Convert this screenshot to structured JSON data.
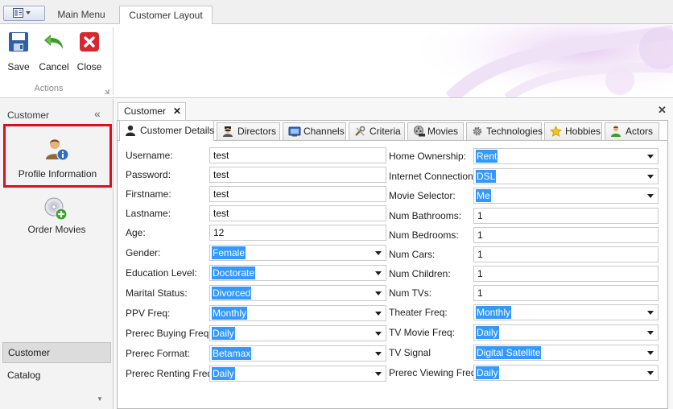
{
  "app_tabs": {
    "main_menu": "Main Menu",
    "customer_layout": "Customer Layout"
  },
  "ribbon": {
    "save": "Save",
    "cancel": "Cancel",
    "close": "Close",
    "group_caption": "Actions"
  },
  "nav": {
    "title": "Customer",
    "collapse_glyph": "«",
    "items": [
      {
        "label": "Profile Information",
        "icon": "user-info-icon"
      },
      {
        "label": "Order Movies",
        "icon": "cd-add-icon"
      }
    ],
    "groups": [
      "Customer",
      "Catalog"
    ]
  },
  "document": {
    "tab_label": "Customer",
    "close_glyph": "✕"
  },
  "tabs": [
    {
      "label": "Customer Details",
      "icon": "person-icon"
    },
    {
      "label": "Directors",
      "icon": "director-icon"
    },
    {
      "label": "Channels",
      "icon": "tv-icon"
    },
    {
      "label": "Criteria",
      "icon": "tools-icon"
    },
    {
      "label": "Movies",
      "icon": "film-reel-icon"
    },
    {
      "label": "Technologies",
      "icon": "gear-icon"
    },
    {
      "label": "Hobbies",
      "icon": "star-icon"
    },
    {
      "label": "Actors",
      "icon": "actor-icon"
    }
  ],
  "form_left": [
    {
      "label": "Username:",
      "value": "test",
      "type": "text"
    },
    {
      "label": "Password:",
      "value": "test",
      "type": "text"
    },
    {
      "label": "Firstname:",
      "value": "test",
      "type": "text"
    },
    {
      "label": "Lastname:",
      "value": "test",
      "type": "text"
    },
    {
      "label": "Age:",
      "value": "12",
      "type": "text"
    },
    {
      "label": "Gender:",
      "value": "Female",
      "type": "combo"
    },
    {
      "label": "Education Level:",
      "value": "Doctorate",
      "type": "combo"
    },
    {
      "label": "Marital Status:",
      "value": "Divorced",
      "type": "combo"
    },
    {
      "label": "PPV Freq:",
      "value": "Monthly",
      "type": "combo"
    },
    {
      "label": "Prerec Buying Freq:",
      "value": "Daily",
      "type": "combo"
    },
    {
      "label": "Prerec Format:",
      "value": "Betamax",
      "type": "combo"
    },
    {
      "label": "Prerec Renting Freq:",
      "value": "Daily",
      "type": "combo"
    }
  ],
  "form_right": [
    {
      "label": "Home Ownership:",
      "value": "Rent",
      "type": "combo"
    },
    {
      "label": "Internet Connection:",
      "value": "DSL",
      "type": "combo"
    },
    {
      "label": "Movie Selector:",
      "value": "Me",
      "type": "combo"
    },
    {
      "label": "Num Bathrooms:",
      "value": "1",
      "type": "text"
    },
    {
      "label": "Num Bedrooms:",
      "value": "1",
      "type": "text"
    },
    {
      "label": "Num Cars:",
      "value": "1",
      "type": "text"
    },
    {
      "label": "Num Children:",
      "value": "1",
      "type": "text"
    },
    {
      "label": "Num TVs:",
      "value": "1",
      "type": "text"
    },
    {
      "label": "Theater Freq:",
      "value": "Monthly",
      "type": "combo"
    },
    {
      "label": "TV Movie Freq:",
      "value": "Daily",
      "type": "combo"
    },
    {
      "label": "TV Signal",
      "value": "Digital Satellite",
      "type": "combo"
    },
    {
      "label": "Prerec Viewing Freq:",
      "value": "Daily",
      "type": "combo"
    }
  ],
  "colors": {
    "selection": "#3399ff",
    "highlight_border": "#d7121e",
    "ribbon_accent": "#e9d3f3"
  }
}
